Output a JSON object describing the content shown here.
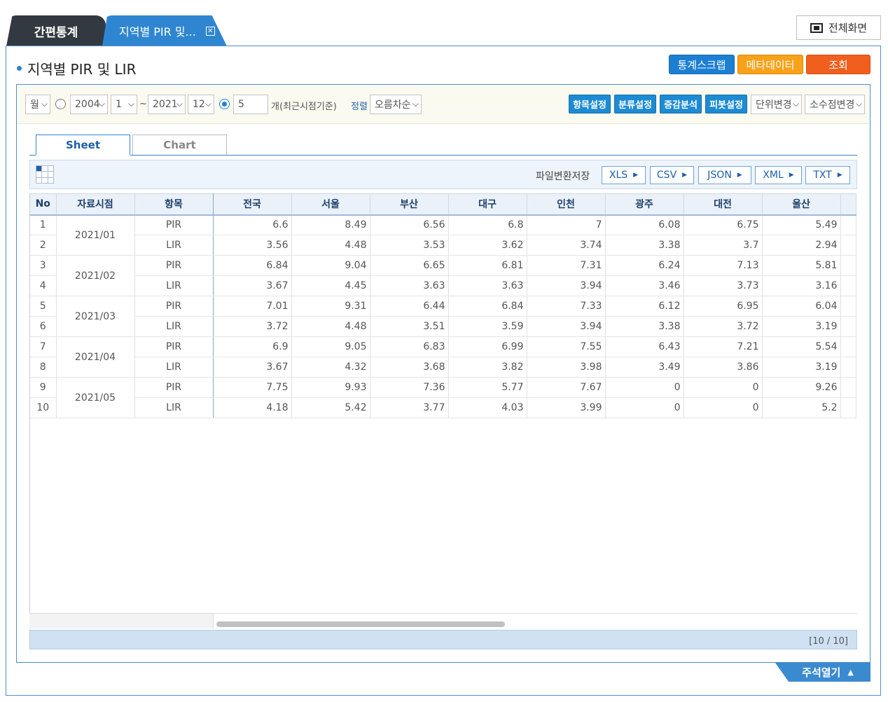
{
  "tabs": {
    "simple": "간편통계",
    "active": "지역별 PIR 및...",
    "close_glyph": "✕"
  },
  "fullscreen_label": "전체화면",
  "page_title": "지역별 PIR 및 LIR",
  "header_buttons": {
    "scrap": "통계스크랩",
    "meta": "메타데이터",
    "query": "조회"
  },
  "filters": {
    "period_type": "월",
    "start_year": "2004",
    "start_month": "1",
    "tilde": "~",
    "end_year": "2021",
    "end_month": "12",
    "recent_count": "5",
    "recent_suffix": "개(최근시점기준)",
    "sort_label": "정렬",
    "sort_value": "오름차순",
    "arrow": "⌵",
    "buttons": {
      "items": "항목설정",
      "class": "분류설정",
      "analysis": "증감분석",
      "pivot": "피봇설정"
    },
    "unit_change": "단위변경",
    "decimal_change": "소수점변경"
  },
  "view_tabs": {
    "sheet": "Sheet",
    "chart": "Chart"
  },
  "export": {
    "label": "파일변환저장",
    "xls": "XLS",
    "csv": "CSV",
    "json": "JSON",
    "xml": "XML",
    "txt": "TXT",
    "tri": "▶"
  },
  "table": {
    "headers": {
      "no": "No",
      "date": "자료시점",
      "item": "항목",
      "r1": "전국",
      "r2": "서울",
      "r3": "부산",
      "r4": "대구",
      "r5": "인천",
      "r6": "광주",
      "r7": "대전",
      "r8": "울산"
    },
    "rows": [
      {
        "no": "1",
        "date": "2021/01",
        "item": "PIR",
        "v": [
          "6.6",
          "8.49",
          "6.56",
          "6.8",
          "7",
          "6.08",
          "6.75",
          "5.49"
        ]
      },
      {
        "no": "2",
        "date": "",
        "item": "LIR",
        "v": [
          "3.56",
          "4.48",
          "3.53",
          "3.62",
          "3.74",
          "3.38",
          "3.7",
          "2.94"
        ]
      },
      {
        "no": "3",
        "date": "2021/02",
        "item": "PIR",
        "v": [
          "6.84",
          "9.04",
          "6.65",
          "6.81",
          "7.31",
          "6.24",
          "7.13",
          "5.81"
        ]
      },
      {
        "no": "4",
        "date": "",
        "item": "LIR",
        "v": [
          "3.67",
          "4.45",
          "3.63",
          "3.63",
          "3.94",
          "3.46",
          "3.73",
          "3.16"
        ]
      },
      {
        "no": "5",
        "date": "2021/03",
        "item": "PIR",
        "v": [
          "7.01",
          "9.31",
          "6.44",
          "6.84",
          "7.33",
          "6.12",
          "6.95",
          "6.04"
        ]
      },
      {
        "no": "6",
        "date": "",
        "item": "LIR",
        "v": [
          "3.72",
          "4.48",
          "3.51",
          "3.59",
          "3.94",
          "3.38",
          "3.72",
          "3.19"
        ]
      },
      {
        "no": "7",
        "date": "2021/04",
        "item": "PIR",
        "v": [
          "6.9",
          "9.05",
          "6.83",
          "6.99",
          "7.55",
          "6.43",
          "7.21",
          "5.54"
        ]
      },
      {
        "no": "8",
        "date": "",
        "item": "LIR",
        "v": [
          "3.67",
          "4.32",
          "3.68",
          "3.82",
          "3.98",
          "3.49",
          "3.86",
          "3.19"
        ]
      },
      {
        "no": "9",
        "date": "2021/05",
        "item": "PIR",
        "v": [
          "7.75",
          "9.93",
          "7.36",
          "5.77",
          "7.67",
          "0",
          "0",
          "9.26"
        ]
      },
      {
        "no": "10",
        "date": "",
        "item": "LIR",
        "v": [
          "4.18",
          "5.42",
          "3.77",
          "4.03",
          "3.99",
          "0",
          "0",
          "5.2"
        ]
      }
    ]
  },
  "pager": "[10 / 10]",
  "notes_tab": {
    "label": "주석열기",
    "arrow": "▲"
  },
  "colors": {
    "accent_blue": "#2f86d0",
    "meta_orange": "#f8a21a",
    "query_orange": "#f15f1e",
    "dark_tab": "#333940"
  }
}
